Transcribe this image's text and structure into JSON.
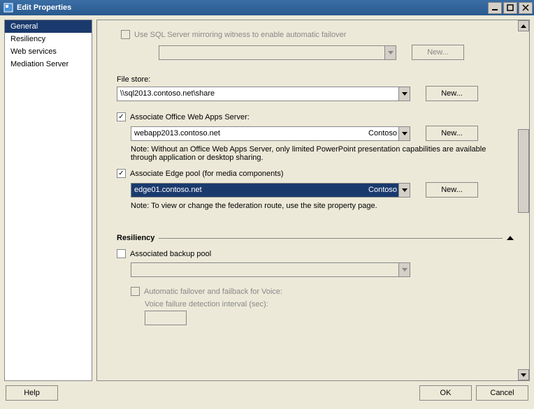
{
  "window": {
    "title": "Edit Properties"
  },
  "sidebar": {
    "items": [
      {
        "label": "General",
        "selected": true
      },
      {
        "label": "Resiliency",
        "selected": false
      },
      {
        "label": "Web services",
        "selected": false
      },
      {
        "label": "Mediation Server",
        "selected": false
      }
    ]
  },
  "mirroring": {
    "label": "Use SQL Server mirroring witness to enable automatic failover",
    "new": "New..."
  },
  "filestore": {
    "label": "File store:",
    "value": "\\\\sql2013.contoso.net\\share",
    "new": "New..."
  },
  "owa": {
    "label": "Associate Office Web Apps Server:",
    "value": "webapp2013.contoso.net",
    "suffix": "Contoso",
    "new": "New...",
    "note": "Note: Without an Office Web Apps Server, only limited PowerPoint presentation capabilities are available through application or desktop sharing."
  },
  "edge": {
    "label": "Associate Edge pool (for media components)",
    "value": "edge01.contoso.net",
    "suffix": "Contoso",
    "new": "New...",
    "note": "Note: To view or change the federation route, use the site property page."
  },
  "resiliency": {
    "heading": "Resiliency",
    "backup_label": "Associated backup pool",
    "auto_label": "Automatic failover and failback for Voice:",
    "voice_label": "Voice failure detection interval (sec):"
  },
  "footer": {
    "help": "Help",
    "ok": "OK",
    "cancel": "Cancel"
  }
}
